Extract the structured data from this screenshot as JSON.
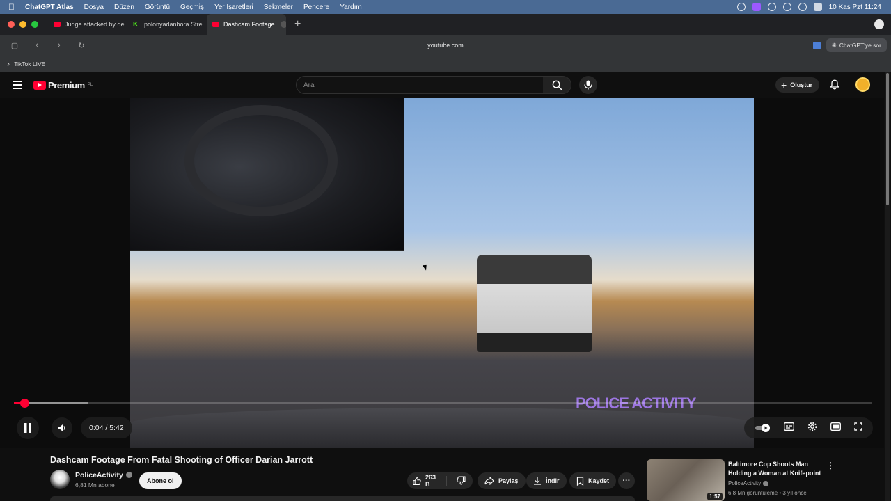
{
  "menubar": {
    "app": "ChatGPT Atlas",
    "items": [
      "Dosya",
      "Düzen",
      "Görüntü",
      "Geçmiş",
      "Yer İşaretleri",
      "Sekmeler",
      "Pencere",
      "Yardım"
    ],
    "clock": "10 Kas Pzt  11:24"
  },
  "tabs": [
    {
      "label": "Judge attacked by de",
      "icon": "youtube-icon"
    },
    {
      "label": "polonyadanbora Stre",
      "icon": "kick-icon"
    },
    {
      "label": "Dashcam Footage",
      "icon": "youtube-icon",
      "active": true
    }
  ],
  "address": {
    "url": "youtube.com",
    "ask_label": "ChatGPT'ye sor"
  },
  "bookmarks": [
    {
      "label": "TikTok LIVE"
    }
  ],
  "youtube": {
    "logo_text": "Premium",
    "logo_country": "PL",
    "search_placeholder": "Ara",
    "create_label": "Oluştur"
  },
  "player": {
    "current_time": "0:04",
    "duration": "5:42",
    "time_separator": " / ",
    "progress_fraction": 0.012,
    "watermark": "POLICE ACTIVITY"
  },
  "video": {
    "title": "Dashcam Footage From Fatal Shooting of Officer Darian Jarrott",
    "channel": "PoliceActivity",
    "subscribers": "6,81 Mn abone",
    "subscribe_label": "Abone ol",
    "likes": "263 B",
    "share_label": "Paylaş",
    "download_label": "İndir",
    "save_label": "Kaydet"
  },
  "recommendation": {
    "title": "Baltimore Cop Shoots Man Holding a Woman at Knifepoint",
    "channel": "PoliceActivity",
    "meta": "6,8 Mn görüntüleme • 3 yıl önce",
    "duration": "1:57"
  },
  "colors": {
    "accent": "#ff0033",
    "menubar": "#4a6a94",
    "background": "#0f0f0f"
  }
}
